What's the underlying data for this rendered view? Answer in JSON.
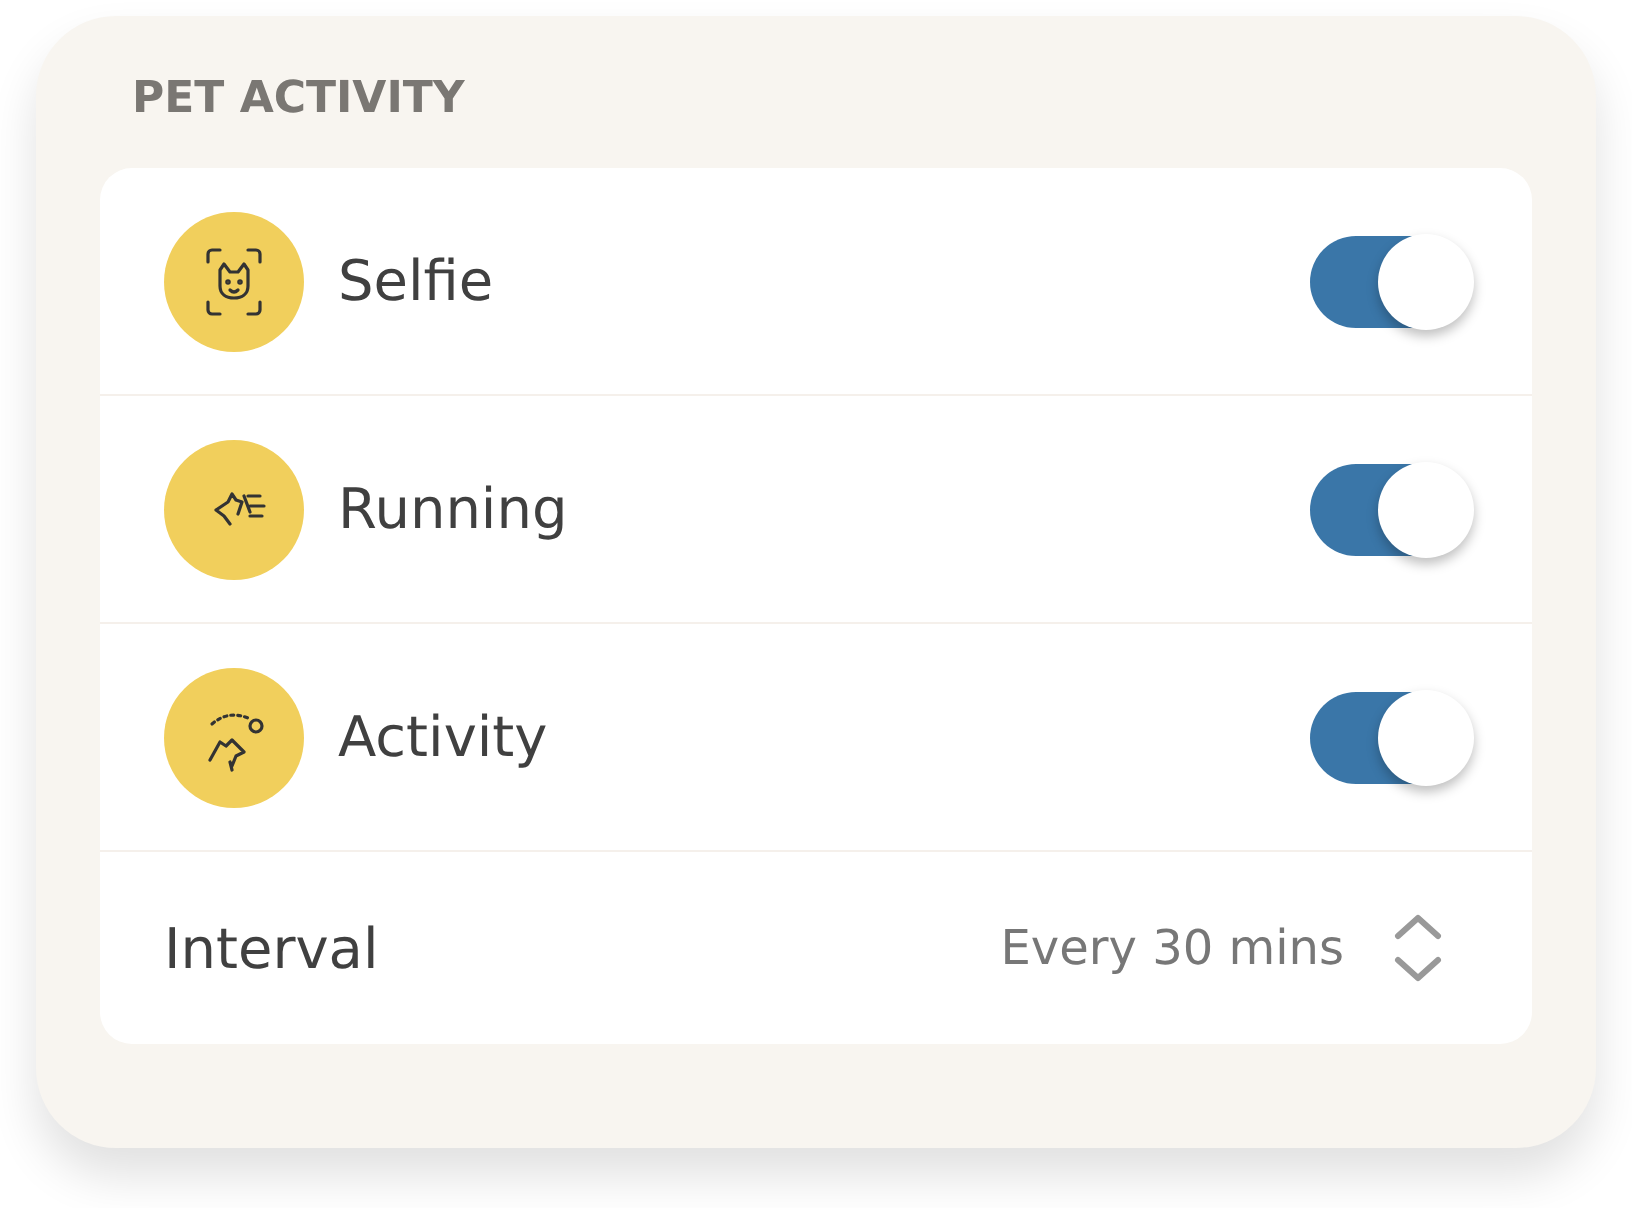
{
  "title": "PET ACTIVITY",
  "items": [
    {
      "kind": "toggle",
      "label": "Selfie",
      "on": true
    },
    {
      "kind": "toggle",
      "label": "Running",
      "on": true
    },
    {
      "kind": "toggle",
      "label": "Activity",
      "on": true
    },
    {
      "kind": "select",
      "label": "Interval",
      "value": "Every 30 mins"
    }
  ]
}
